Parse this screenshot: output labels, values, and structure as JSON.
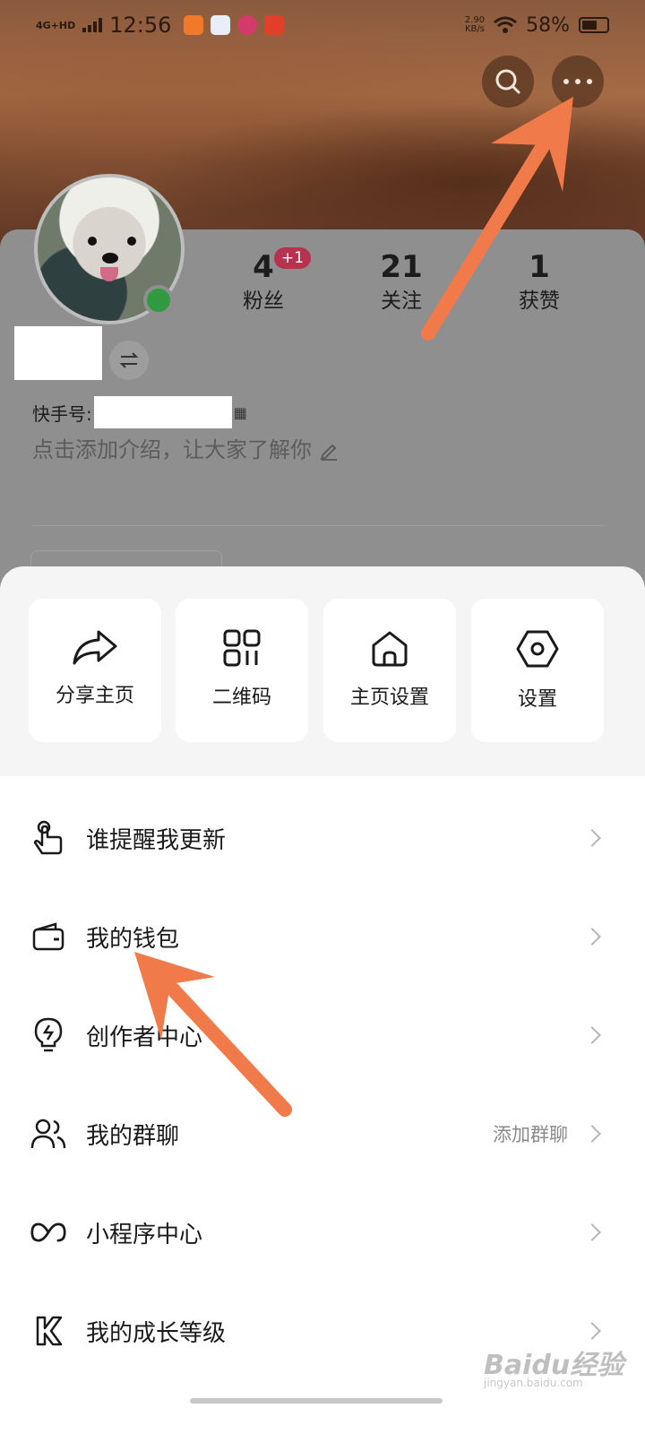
{
  "status_bar": {
    "network": "4G+HD",
    "time": "12:56",
    "speed_value": "2.90",
    "speed_unit": "KB/s",
    "battery": "58%"
  },
  "header": {
    "search_icon": "search-icon",
    "more_icon": "more-dots-icon"
  },
  "profile": {
    "stats": [
      {
        "value": "4",
        "label": "粉丝",
        "badge": "+1"
      },
      {
        "value": "21",
        "label": "关注"
      },
      {
        "value": "1",
        "label": "获赞"
      }
    ],
    "kuaishou_id_label": "快手号:",
    "intro_placeholder": "点击添加介绍，让大家了解你"
  },
  "quick_actions": [
    {
      "label": "分享主页",
      "icon": "share-icon"
    },
    {
      "label": "二维码",
      "icon": "qr-code-icon"
    },
    {
      "label": "主页设置",
      "icon": "home-settings-icon"
    },
    {
      "label": "设置",
      "icon": "settings-hex-icon"
    }
  ],
  "menu": [
    {
      "label": "谁提醒我更新",
      "icon": "tap-hand-icon"
    },
    {
      "label": "我的钱包",
      "icon": "wallet-icon"
    },
    {
      "label": "创作者中心",
      "icon": "lightbulb-icon"
    },
    {
      "label": "我的群聊",
      "icon": "group-icon",
      "extra": "添加群聊"
    },
    {
      "label": "小程序中心",
      "icon": "mini-program-icon"
    },
    {
      "label": "我的成长等级",
      "icon": "k-level-icon"
    }
  ],
  "watermark": {
    "text": "Baidu经验",
    "sub": "jingyan.baidu.com"
  },
  "colors": {
    "accent_arrow": "#f07a4a",
    "badge": "#b7324e",
    "online": "#2f9a3f"
  }
}
